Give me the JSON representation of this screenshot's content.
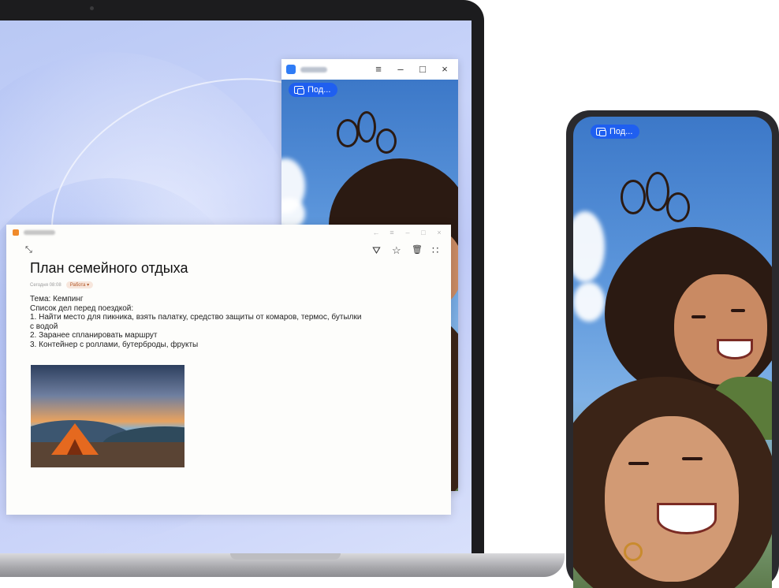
{
  "laptop": {
    "mirror_window": {
      "menu_icon": "≡",
      "minimize_icon": "–",
      "maximize_icon": "□",
      "close_icon": "×",
      "share_pill": "Под..."
    },
    "notes_window": {
      "controls": {
        "back": "←",
        "menu": "≡",
        "minimize": "–",
        "maximize": "□",
        "close": "×"
      },
      "collapse_icon": "⤡",
      "tools": {
        "share": "⛛",
        "favorite": "☆",
        "delete": "🗑",
        "more": "∷"
      },
      "title": "План семейного отдыха",
      "meta": {
        "timestamp": "Сегодня 08:08",
        "category": "Работа ▾"
      },
      "body_lines": [
        "Тема: Кемпинг",
        "Список дел перед поездкой:",
        "1. Найти место для пикника, взять палатку, средство защиты от комаров, термос, бутылки",
        "с водой",
        "2. Заранее спланировать маршрут",
        "3. Контейнер с роллами, бутерброды, фрукты"
      ]
    }
  },
  "phone": {
    "share_pill": "Под..."
  },
  "colors": {
    "accent": "#1f5ff0",
    "notes_icon": "#f08a2b",
    "tent": "#e5691f"
  }
}
